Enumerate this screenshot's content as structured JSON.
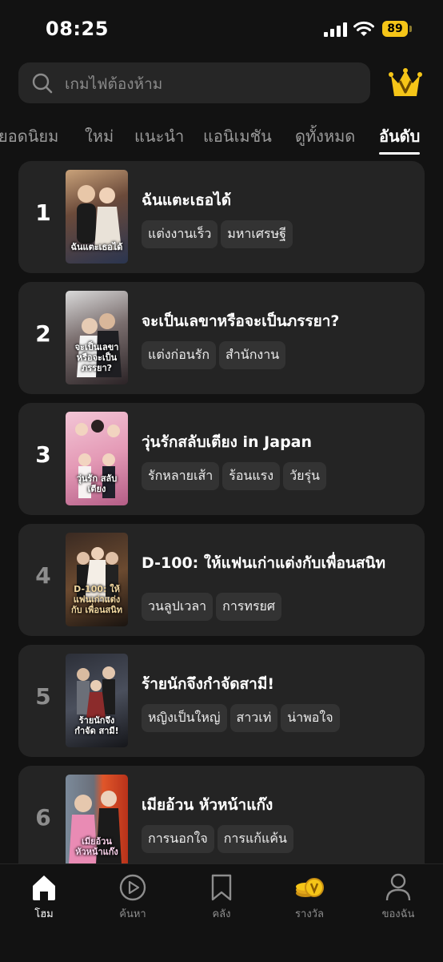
{
  "status_bar": {
    "time": "08:25",
    "battery": "89"
  },
  "search": {
    "placeholder": "เกมไฟต้องห้าม"
  },
  "tabs": [
    "ยอดนิยม",
    "ใหม่",
    "แนะนำ",
    "แอนิเมชัน",
    "ดูทั้งหมด",
    "อันดับ"
  ],
  "active_tab": "อันดับ",
  "rankings": [
    {
      "rank": "1",
      "title": "ฉันแตะเธอได้",
      "tags": [
        "แต่งงานเร็ว",
        "มหาเศรษฐี"
      ],
      "poster_text": "ฉันแตะเธอได้"
    },
    {
      "rank": "2",
      "title": "จะเป็นเลขาหรือจะเป็นภรรยา?",
      "tags": [
        "แต่งก่อนรัก",
        "สำนักงาน"
      ],
      "poster_text": "จะเป็นเลขา หรือจะเป็นภรรยา?"
    },
    {
      "rank": "3",
      "title": "วุ่นรักสลับเตียง in Japan",
      "tags": [
        "รักหลายเส้า",
        "ร้อนแรง",
        "วัยรุ่น"
      ],
      "poster_text": "วุ่นรัก สลับเตียง"
    },
    {
      "rank": "4",
      "title": "D-100: ให้แฟนเก่าแต่งกับเพื่อนสนิท",
      "tags": [
        "วนลูปเวลา",
        "การทรยศ"
      ],
      "poster_text": "D-100: ให้แฟนเก่าแต่งกับ เพื่อนสนิท"
    },
    {
      "rank": "5",
      "title": "ร้ายนักจึงกำจัดสามี!",
      "tags": [
        "หญิงเป็นใหญ่",
        "สาวเท่",
        "น่าพอใจ"
      ],
      "poster_text": "ร้ายนักจึงกำจัด สามี!"
    },
    {
      "rank": "6",
      "title": "เมียอ้วน หัวหน้าแก๊ง",
      "tags": [
        "การนอกใจ",
        "การแก้แค้น"
      ],
      "poster_text": "เมียอ้วน หัวหน้าแก๊ง"
    }
  ],
  "bottom_nav": [
    {
      "label": "โฮม",
      "icon": "home-icon",
      "active": true
    },
    {
      "label": "ค้นหา",
      "icon": "play-circle-icon",
      "active": false
    },
    {
      "label": "คลัง",
      "icon": "bookmark-icon",
      "active": false
    },
    {
      "label": "รางวัล",
      "icon": "coins-icon",
      "active": false
    },
    {
      "label": "ของฉัน",
      "icon": "user-icon",
      "active": false
    }
  ],
  "colors": {
    "accent": "#f5c518",
    "background": "#121212",
    "card": "#242424",
    "tag": "#333333"
  }
}
